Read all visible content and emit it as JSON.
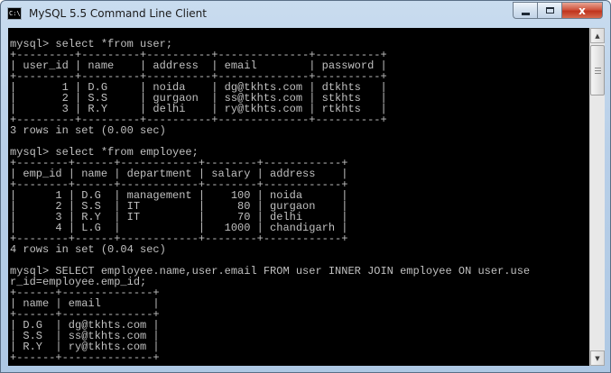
{
  "window": {
    "title": "MySQL 5.5 Command Line Client",
    "icon_text": "C:\\",
    "controls": {
      "minimize": "minimize-icon",
      "maximize": "maximize-icon",
      "close": "x"
    }
  },
  "console": {
    "lines": [
      "mysql> select *from user;",
      "+---------+---------+----------+--------------+----------+",
      "| user_id | name    | address  | email        | password |",
      "+---------+---------+----------+--------------+----------+",
      "|       1 | D.G     | noida    | dg@tkhts.com | dtkhts   |",
      "|       2 | S.S     | gurgaon  | ss@tkhts.com | stkhts   |",
      "|       3 | R.Y     | delhi    | ry@tkhts.com | rtkhts   |",
      "+---------+---------+----------+--------------+----------+",
      "3 rows in set (0.00 sec)",
      "",
      "mysql> select *from employee;",
      "+--------+------+------------+--------+------------+",
      "| emp_id | name | department | salary | address    |",
      "+--------+------+------------+--------+------------+",
      "|      1 | D.G  | management |    100 | noida      |",
      "|      2 | S.S  | IT         |     80 | gurgaon    |",
      "|      3 | R.Y  | IT         |     70 | delhi      |",
      "|      4 | L.G  |            |   1000 | chandigarh |",
      "+--------+------+------------+--------+------------+",
      "4 rows in set (0.04 sec)",
      "",
      "mysql> SELECT employee.name,user.email FROM user INNER JOIN employee ON user.use",
      "r_id=employee.emp_id;",
      "+------+--------------+",
      "| name | email        |",
      "+------+--------------+",
      "| D.G  | dg@tkhts.com |",
      "| S.S  | ss@tkhts.com |",
      "| R.Y  | ry@tkhts.com |",
      "+------+--------------+"
    ]
  },
  "scrollbar": {
    "up": "▲",
    "down": "▼"
  }
}
